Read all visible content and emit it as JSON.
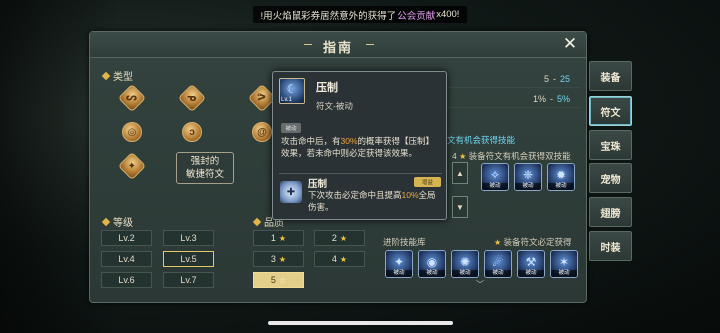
{
  "notice": {
    "prefix": "!用火焰鼠彩券居然意外的获得了",
    "highlight": "公会贡献",
    "suffix": "x400!"
  },
  "panel": {
    "title": "指南",
    "close_icon": "close-icon"
  },
  "left": {
    "type_label": "类型",
    "rune_icons": [
      "rune-curve-icon",
      "rune-hook-icon",
      "rune-claw-icon",
      "rune-ring-icon",
      "rune-swirl-icon",
      "rune-spiral-icon",
      "rune-leaf-icon"
    ],
    "sealed_button": {
      "line1": "强封的",
      "line2": "敏捷符文"
    },
    "level_label": "等级",
    "levels": [
      "Lv.2",
      "Lv.3",
      "Lv.4",
      "Lv.5",
      "Lv.6",
      "Lv.7"
    ],
    "selected_level": "Lv.5",
    "quality_label": "品质",
    "qualities": [
      "1",
      "2",
      "3",
      "4",
      "5"
    ],
    "selected_quality": "5"
  },
  "right": {
    "stat1": {
      "from": "5",
      "to": "25"
    },
    "stat2": {
      "from": "1%",
      "to": "5%"
    },
    "chance_text": "文有机会获得技能",
    "dual_label": "装备符文有机会获得双技能",
    "adv_label": "进阶技能库",
    "adv_right_label": "装备符文必定获得",
    "skill_tag": "被动"
  },
  "tabs": [
    "装备",
    "符文",
    "宝珠",
    "宠物",
    "翅膀",
    "时装"
  ],
  "active_tab": "符文",
  "tooltip": {
    "name": "压制",
    "level": "Lv.1",
    "type": "符文-被动",
    "tag": "被动",
    "desc_a": "攻击命中后，有",
    "desc_pct": "30%",
    "desc_b": "的概率获得【压制】效果，若未命中则必定获得该效果。",
    "skill_name": "压制",
    "skill_badge": "增益",
    "skill_desc_a": "下次攻击必定命中且提高",
    "skill_pct": "10%",
    "skill_desc_b": "全局伤害。"
  },
  "colors": {
    "accent_gold": "#e0b54a",
    "highlight_cyan": "#6fd6f0",
    "highlight_orange": "#f1a53b",
    "notice_pink": "#e59cf0"
  }
}
